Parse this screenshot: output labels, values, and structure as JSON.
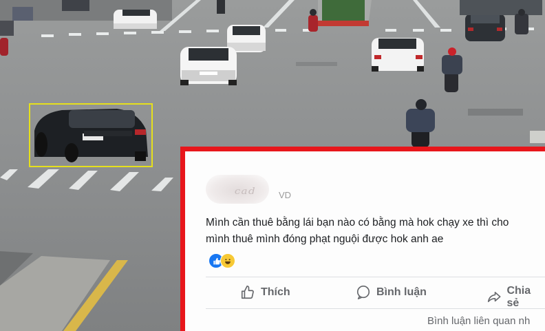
{
  "post": {
    "author_suffix": "VD",
    "text_line1": "Mình cần thuê bằng lái bạn nào có bằng mà hok chạy xe thì cho",
    "text_line2": "mình thuê mình đóng phạt nguội được hok anh ae",
    "actions": {
      "like": "Thích",
      "comment": "Bình luận",
      "share": "Chia sẻ"
    },
    "related_comments": "Bình luận liên quan nh"
  },
  "colors": {
    "highlight_box": "#e8161b",
    "detection_box": "#e6e01c",
    "like_blue": "#1877f2",
    "text_gray": "#65676b"
  },
  "icons": [
    "like-reaction-icon",
    "haha-reaction-icon",
    "thumbs-up-icon",
    "comment-bubble-icon",
    "share-arrow-icon"
  ]
}
